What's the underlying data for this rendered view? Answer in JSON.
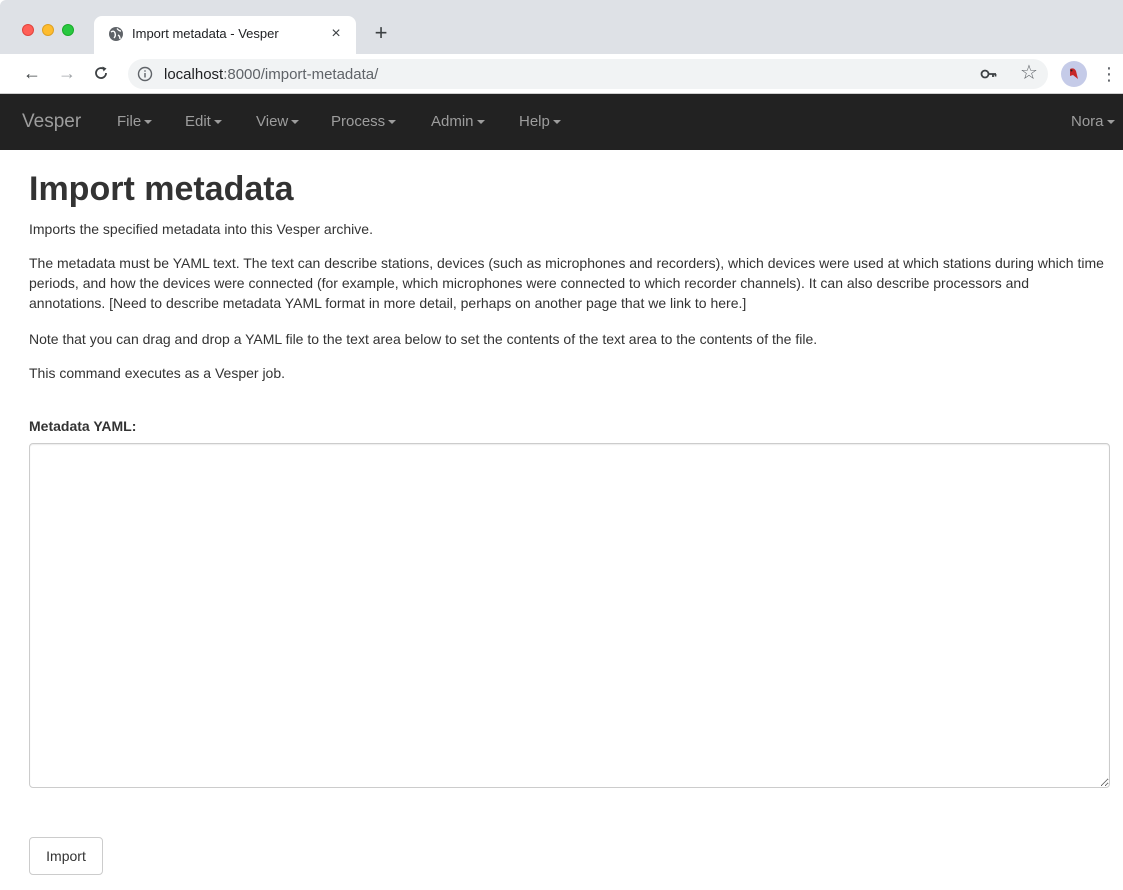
{
  "browser": {
    "tab_title": "Import metadata - Vesper",
    "tab_close": "×",
    "new_tab": "+",
    "url_host": "localhost",
    "url_path": ":8000/import-metadata/",
    "icons": [
      "globe-icon",
      "close-icon",
      "plus-icon",
      "back-arrow-icon",
      "forward-arrow-icon",
      "reload-icon",
      "info-icon",
      "key-icon",
      "star-icon",
      "profile-avatar-icon",
      "more-vert-icon"
    ]
  },
  "navbar": {
    "brand": "Vesper",
    "menus": [
      "File",
      "Edit",
      "View",
      "Process",
      "Admin",
      "Help"
    ],
    "user": "Nora",
    "background": "#222222",
    "text_color": "#9d9d9d"
  },
  "page": {
    "title": "Import metadata",
    "paragraphs": [
      "Imports the specified metadata into this Vesper archive.",
      "The metadata must be YAML text. The text can describe stations, devices (such as microphones and recorders), which devices were used at which stations during which time periods, and how the devices were connected (for example, which microphones were connected to which recorder channels). It can also describe processors and annotations. [Need to describe metadata YAML format in more detail, perhaps on another page that we link to here.]",
      "Note that you can drag and drop a YAML file to the text area below to set the contents of the text area to the contents of the file.",
      "This command executes as a Vesper job."
    ],
    "yaml_label": "Metadata YAML:",
    "yaml_value": "",
    "import_button": "Import"
  }
}
